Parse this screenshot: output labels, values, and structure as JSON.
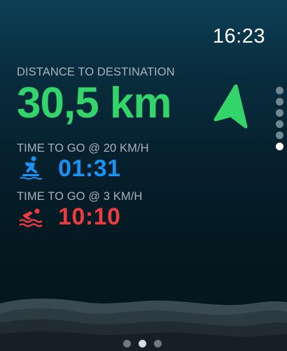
{
  "status_bar": {
    "time": "16:23"
  },
  "distance": {
    "label": "DISTANCE TO DESTINATION",
    "value": "30,5 km",
    "color": "#33d46a",
    "icon": "navigation-arrow-icon"
  },
  "time_to_go": [
    {
      "label": "TIME TO GO @ 20 KM/H",
      "value": "01:31",
      "icon": "surfing-icon",
      "color": "#1a93f4"
    },
    {
      "label": "TIME TO GO @ 3 KM/H",
      "value": "10:10",
      "icon": "swimming-icon",
      "color": "#ee3b3f"
    }
  ],
  "vertical_pager": {
    "count": 6,
    "active_index": 5
  },
  "horizontal_pager": {
    "count": 3,
    "active_index": 1
  }
}
